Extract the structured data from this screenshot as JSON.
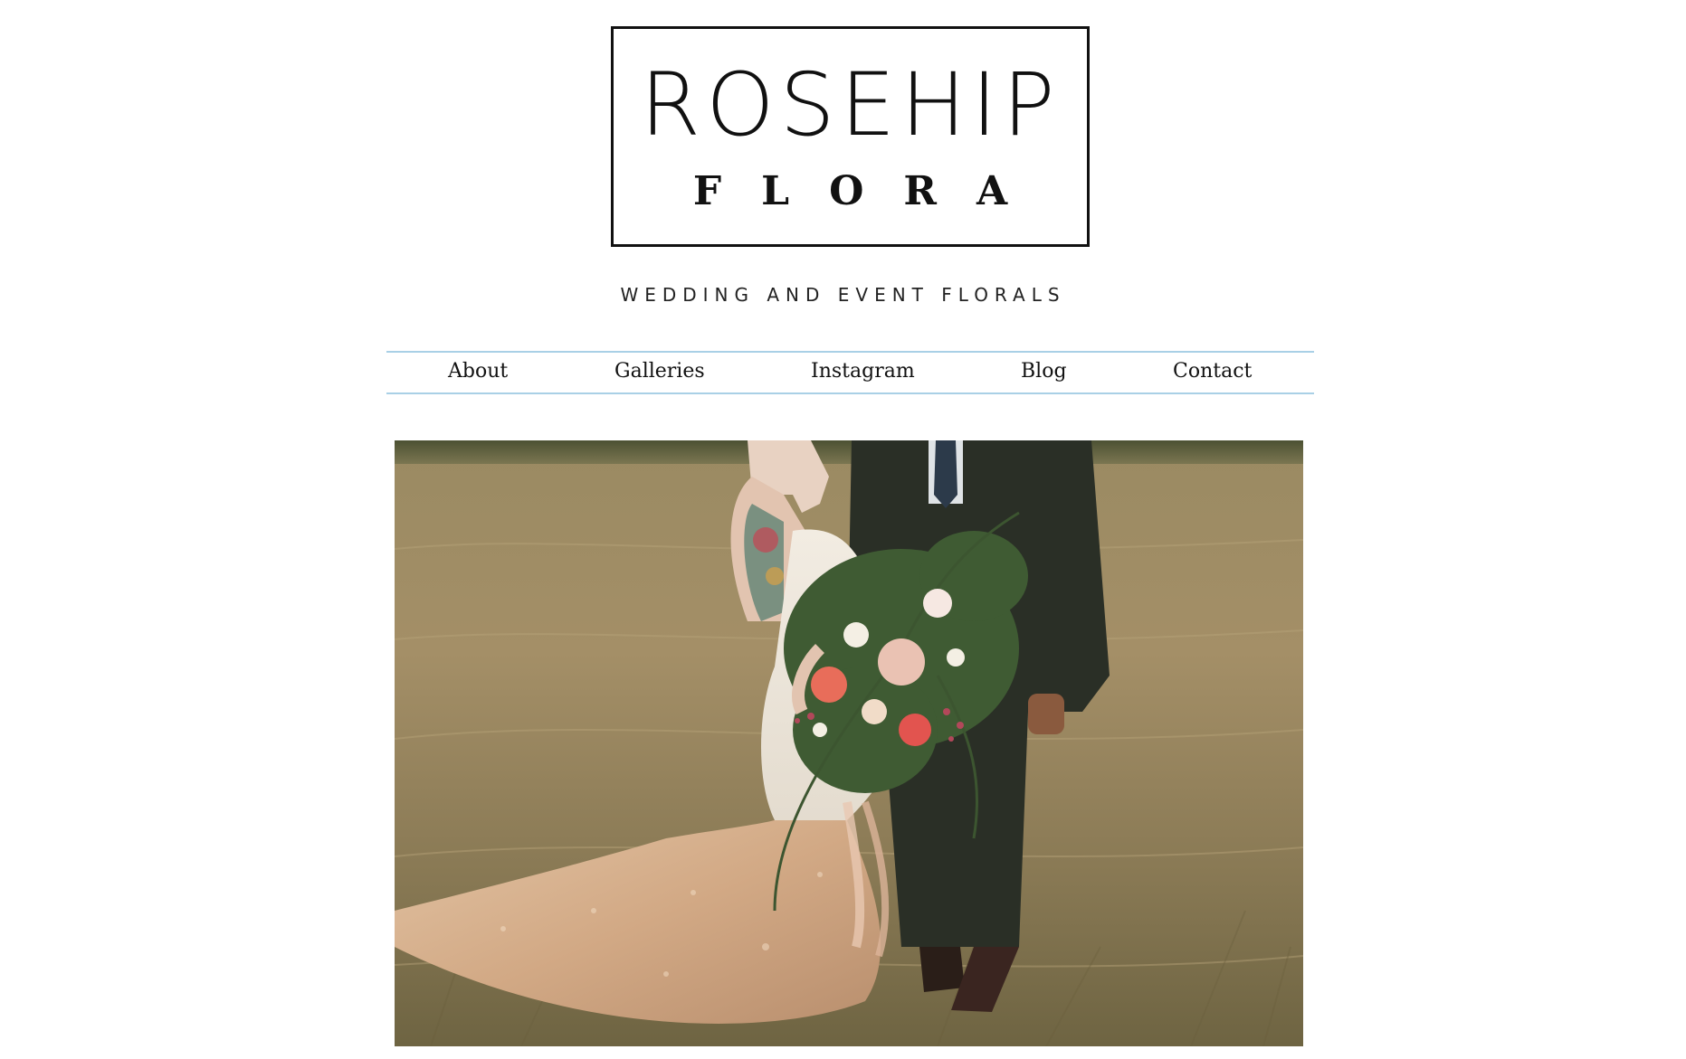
{
  "brand": {
    "logo_line1": "ROSEHIP",
    "logo_line2": "FLORA",
    "tagline": "WEDDING AND EVENT FLORALS"
  },
  "nav": {
    "items": [
      {
        "label": "About"
      },
      {
        "label": "Galleries"
      },
      {
        "label": "Instagram"
      },
      {
        "label": "Blog"
      },
      {
        "label": "Contact"
      }
    ]
  },
  "colors": {
    "nav_rule": "#a9d0e6",
    "text": "#111111"
  }
}
